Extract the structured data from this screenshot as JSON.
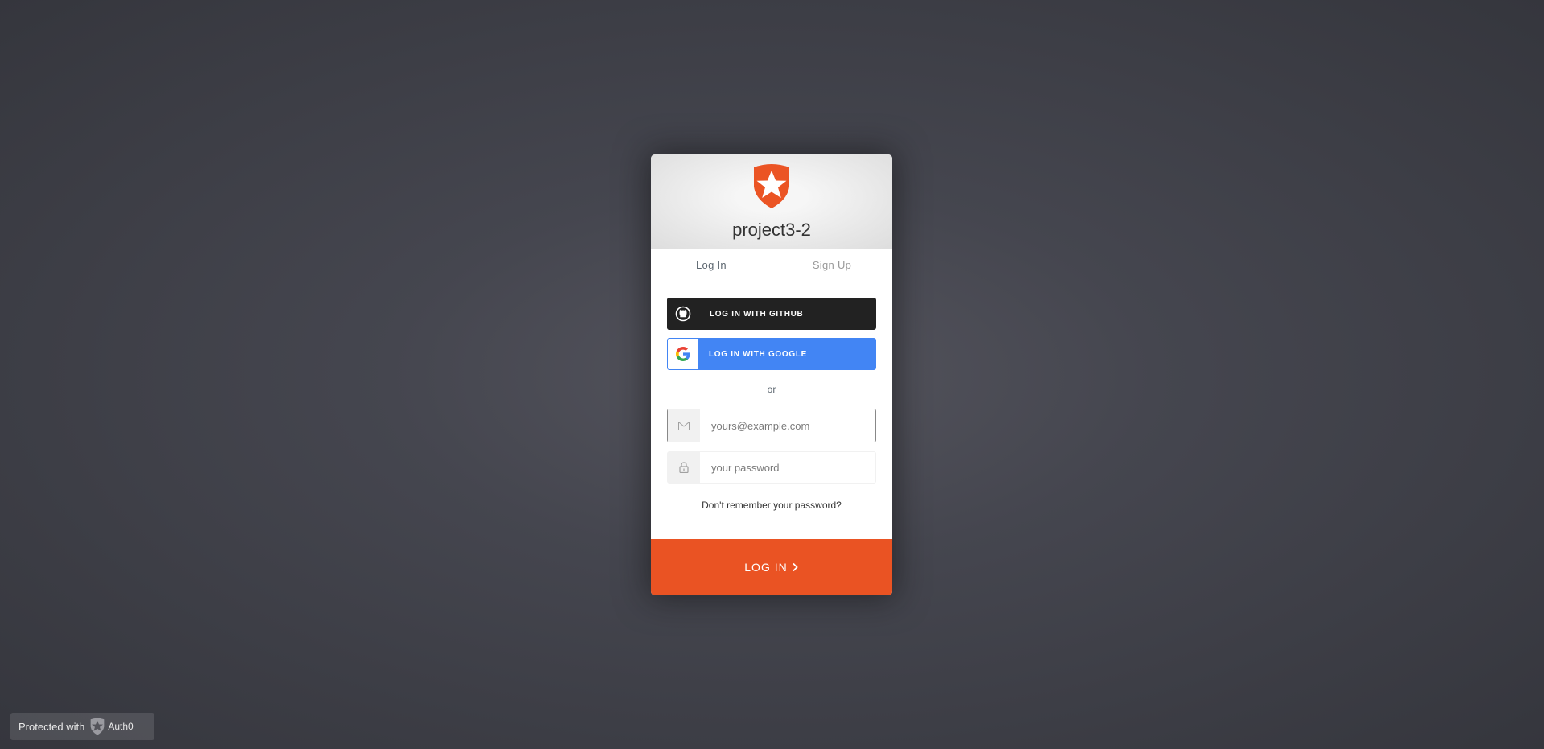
{
  "widget": {
    "app_title": "project3-2",
    "logo_icon": "auth0-shield-star-icon",
    "accent_color": "#ea5323",
    "tabs": [
      {
        "label": "Log In",
        "active": true
      },
      {
        "label": "Sign Up",
        "active": false
      }
    ],
    "social": [
      {
        "label": "LOG IN WITH GITHUB",
        "icon": "github-icon",
        "color": "#222222"
      },
      {
        "label": "LOG IN WITH GOOGLE",
        "icon": "google-icon",
        "color": "#4285f4"
      }
    ],
    "separator": "or",
    "email": {
      "placeholder": "yours@example.com",
      "value": "",
      "icon": "email-icon"
    },
    "password": {
      "placeholder": "your password",
      "value": "",
      "icon": "lock-icon"
    },
    "forgot_link": "Don't remember your password?",
    "submit_label": "LOG IN"
  },
  "badge": {
    "prefix": "Protected with",
    "brand": "Auth0"
  }
}
